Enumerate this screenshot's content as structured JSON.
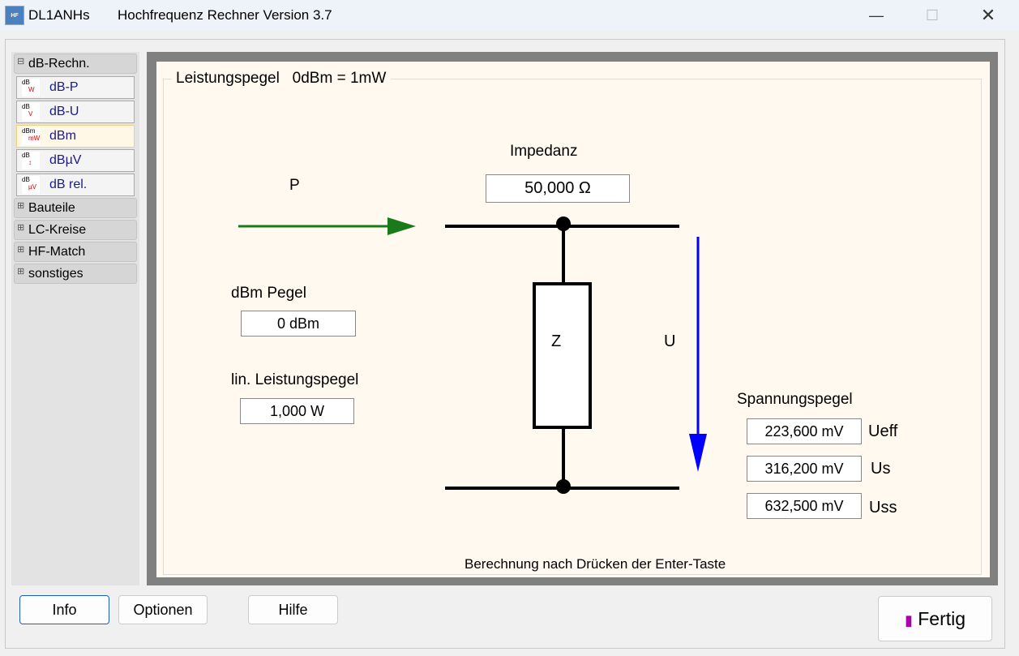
{
  "window": {
    "app_name": "DL1ANHs",
    "title": "Hochfrequenz Rechner Version 3.7",
    "icon_text": "HF"
  },
  "sidebar": {
    "groups": [
      {
        "label": "dB-Rechn.",
        "expanded": true
      },
      {
        "label": "Bauteile"
      },
      {
        "label": "LC-Kreise"
      },
      {
        "label": "HF-Match"
      },
      {
        "label": "sonstiges"
      }
    ],
    "items": [
      {
        "label": "dB-P",
        "icon_top": "dB",
        "icon_bottom": "W"
      },
      {
        "label": "dB-U",
        "icon_top": "dB",
        "icon_bottom": "V"
      },
      {
        "label": "dBm",
        "icon_top": "dBm",
        "icon_bottom": "mW",
        "selected": true
      },
      {
        "label": "dBµV",
        "icon_top": "dB",
        "icon_bottom": "↕"
      },
      {
        "label": "dB rel.",
        "icon_top": "dB",
        "icon_bottom": "µV"
      }
    ]
  },
  "panel": {
    "title": "Leistungspegel   0dBm = 1mW",
    "p_label": "P",
    "impedance_label": "Impedanz",
    "impedance_value": "50,000 Ω",
    "dbm_label": "dBm Pegel",
    "dbm_value": "0 dBm",
    "lin_label": "lin. Leistungspegel",
    "lin_value": "1,000 W",
    "z_label": "Z",
    "u_label": "U",
    "voltage_label": "Spannungspegel",
    "ueff_value": "223,600 mV",
    "ueff_label": "Ueff",
    "us_value": "316,200 mV",
    "us_label": "Us",
    "uss_value": "632,500 mV",
    "uss_label": "Uss",
    "hint": "Berechnung nach Drücken der Enter-Taste",
    "colors": {
      "power_arrow": "#1a7a1a",
      "voltage_arrow": "#0000ff",
      "background": "#fff9ef"
    }
  },
  "buttons": {
    "info": "Info",
    "options": "Optionen",
    "help": "Hilfe",
    "done": "Fertig"
  }
}
